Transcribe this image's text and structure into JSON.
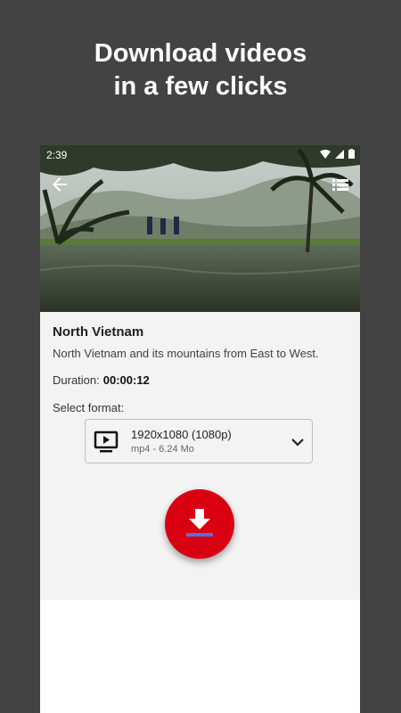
{
  "promo": {
    "line1": "Download videos",
    "line2": "in a few clicks"
  },
  "statusbar": {
    "time": "2:39"
  },
  "video": {
    "title": "North Vietnam",
    "description": "North Vietnam and its mountains from East to West.",
    "duration_label": "Duration:",
    "duration_value": "00:00:12"
  },
  "format": {
    "label": "Select format:",
    "selected_main": "1920x1080 (1080p)",
    "selected_sub": "mp4 - 6.24 Mo"
  },
  "colors": {
    "background": "#434343",
    "fab": "#d90012",
    "fab_underline": "#5b6fd6"
  },
  "icons": {
    "back": "arrow-left-icon",
    "menu": "list-icon",
    "format": "video-screen-icon",
    "chevron": "chevron-down-icon",
    "download": "download-icon"
  }
}
